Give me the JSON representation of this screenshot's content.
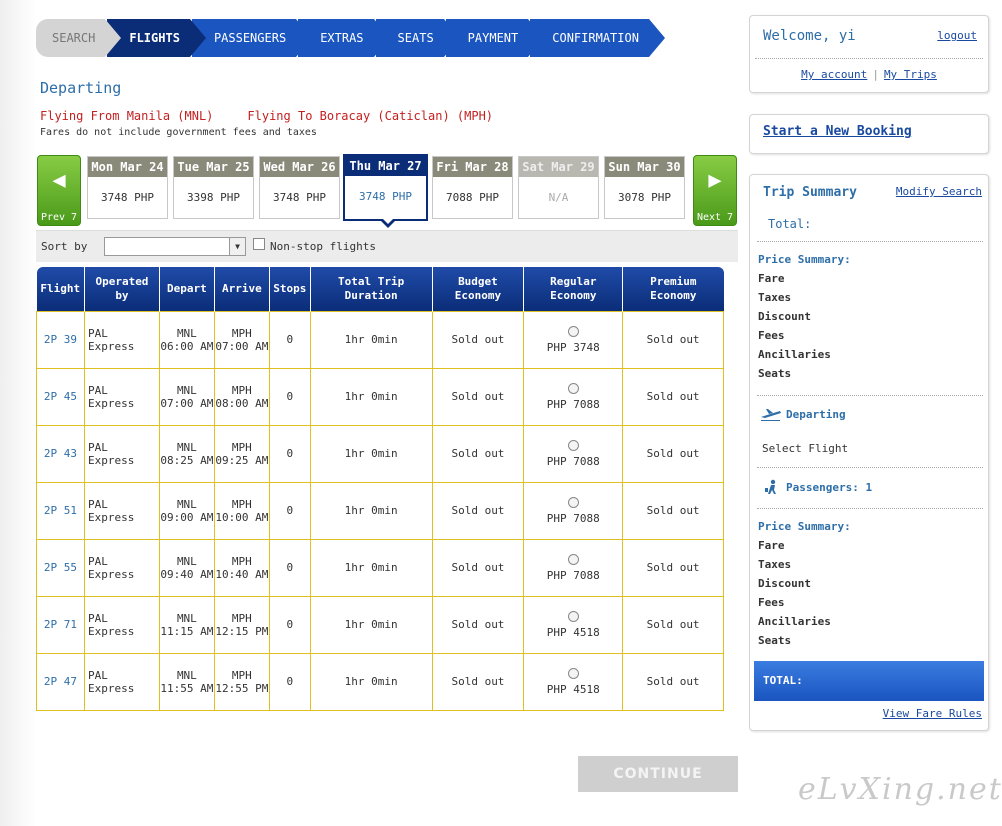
{
  "steps": [
    "SEARCH",
    "FLIGHTS",
    "PASSENGERS",
    "EXTRAS",
    "SEATS",
    "PAYMENT",
    "CONFIRMATION"
  ],
  "active_step": "FLIGHTS",
  "section_title": "Departing",
  "route": {
    "from": "Flying From Manila (MNL)",
    "to": "Flying To Boracay (Caticlan) (MPH)"
  },
  "fare_note": "Fares do not include government fees and taxes",
  "nav": {
    "prev": "Prev 7",
    "next": "Next 7",
    "prev_arrow": "◀",
    "next_arrow": "▶"
  },
  "days": [
    {
      "label": "Mon Mar 24",
      "price": "3748 PHP"
    },
    {
      "label": "Tue Mar 25",
      "price": "3398 PHP"
    },
    {
      "label": "Wed Mar 26",
      "price": "3748 PHP"
    },
    {
      "label": "Thu Mar 27",
      "price": "3748 PHP"
    },
    {
      "label": "Fri Mar 28",
      "price": "7088 PHP"
    },
    {
      "label": "Sat Mar 29",
      "price": "N/A"
    },
    {
      "label": "Sun Mar 30",
      "price": "3078 PHP"
    }
  ],
  "selected_day": "Thu Mar 27",
  "sort": {
    "label": "Sort by",
    "value": "",
    "nonstop_label": "Non-stop flights",
    "nonstop_checked": false
  },
  "table": {
    "headers": {
      "flight": "Flight",
      "operated_by": "Operated by",
      "depart": "Depart",
      "arrive": "Arrive",
      "stops": "Stops",
      "duration": "Total Trip Duration",
      "budget": "Budget Economy",
      "regular": "Regular Economy",
      "premium": "Premium Economy"
    },
    "rows": [
      {
        "flight": "2P 39",
        "operator": "PAL Express",
        "dep_code": "MNL",
        "dep_time": "06:00 AM",
        "arr_code": "MPH",
        "arr_time": "07:00 AM",
        "stops": "0",
        "duration": "1hr 0min",
        "budget": "Sold out",
        "regular": "PHP 3748",
        "premium": "Sold out"
      },
      {
        "flight": "2P 45",
        "operator": "PAL Express",
        "dep_code": "MNL",
        "dep_time": "07:00 AM",
        "arr_code": "MPH",
        "arr_time": "08:00 AM",
        "stops": "0",
        "duration": "1hr 0min",
        "budget": "Sold out",
        "regular": "PHP 7088",
        "premium": "Sold out"
      },
      {
        "flight": "2P 43",
        "operator": "PAL Express",
        "dep_code": "MNL",
        "dep_time": "08:25 AM",
        "arr_code": "MPH",
        "arr_time": "09:25 AM",
        "stops": "0",
        "duration": "1hr 0min",
        "budget": "Sold out",
        "regular": "PHP 7088",
        "premium": "Sold out"
      },
      {
        "flight": "2P 51",
        "operator": "PAL Express",
        "dep_code": "MNL",
        "dep_time": "09:00 AM",
        "arr_code": "MPH",
        "arr_time": "10:00 AM",
        "stops": "0",
        "duration": "1hr 0min",
        "budget": "Sold out",
        "regular": "PHP 7088",
        "premium": "Sold out"
      },
      {
        "flight": "2P 55",
        "operator": "PAL Express",
        "dep_code": "MNL",
        "dep_time": "09:40 AM",
        "arr_code": "MPH",
        "arr_time": "10:40 AM",
        "stops": "0",
        "duration": "1hr 0min",
        "budget": "Sold out",
        "regular": "PHP 7088",
        "premium": "Sold out"
      },
      {
        "flight": "2P 71",
        "operator": "PAL Express",
        "dep_code": "MNL",
        "dep_time": "11:15 AM",
        "arr_code": "MPH",
        "arr_time": "12:15 PM",
        "stops": "0",
        "duration": "1hr 0min",
        "budget": "Sold out",
        "regular": "PHP 4518",
        "premium": "Sold out"
      },
      {
        "flight": "2P 47",
        "operator": "PAL Express",
        "dep_code": "MNL",
        "dep_time": "11:55 AM",
        "arr_code": "MPH",
        "arr_time": "12:55 PM",
        "stops": "0",
        "duration": "1hr 0min",
        "budget": "Sold out",
        "regular": "PHP 4518",
        "premium": "Sold out"
      }
    ]
  },
  "continue_label": "CONTINUE",
  "watermark": "eLvXing.net",
  "account": {
    "welcome": "Welcome, yi",
    "logout": "logout",
    "my_account": "My account",
    "separator": "|",
    "my_trips": "My Trips"
  },
  "new_booking": "Start a New Booking",
  "summary": {
    "title": "Trip Summary",
    "modify": "Modify Search",
    "total": "Total:",
    "price_summary": "Price Summary:",
    "items": [
      "Fare",
      "Taxes",
      "Discount",
      "Fees",
      "Ancillaries",
      "Seats"
    ],
    "departing": "Departing",
    "select_flight": "Select Flight",
    "passengers": "Passengers: 1",
    "total_bar": "TOTAL:",
    "fare_rules": "View Fare Rules"
  },
  "colors": {
    "step_blue": "#1a55c0",
    "step_active": "#0b2d78",
    "link_blue": "#1a4aa0",
    "route_red": "#c42020",
    "table_border": "#e0c020",
    "nav_green": "#5aaa22"
  },
  "icons": [
    "left-arrow-icon",
    "right-arrow-icon",
    "dropdown-arrow-icon",
    "plane-icon",
    "passenger-icon"
  ]
}
